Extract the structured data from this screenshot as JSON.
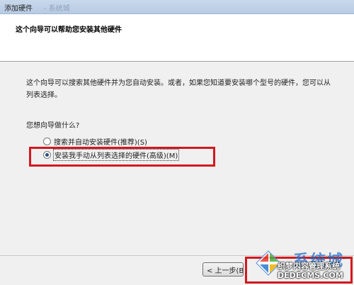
{
  "window": {
    "title": "添加硬件",
    "faded_title": "- 系统城"
  },
  "header": {
    "heading": "这个向导可以帮助您安装其他硬件"
  },
  "content": {
    "description": "这个向导可以搜索其他硬件并为您自动安装。或者，如果您知道要安装哪个型号的硬件，您可以从列表选择。",
    "question": "您想向导做什么?",
    "options": [
      {
        "label": "搜索并自动安装硬件(推荐)(S)",
        "checked": false
      },
      {
        "label": "安装我手动从列表选择的硬件(高级)(M)",
        "checked": true
      }
    ]
  },
  "footer": {
    "back_label": "< 上一步(B)"
  },
  "watermark": {
    "brand": "系统城",
    "domain": "xitongcheng.com",
    "line1": "织梦内容管理系统",
    "line2": "DEDECMS.COM"
  },
  "colors": {
    "highlight_red": "#d4181f",
    "title_bar": "#c9d9ec",
    "dialog_bg": "#f0f0f0"
  }
}
